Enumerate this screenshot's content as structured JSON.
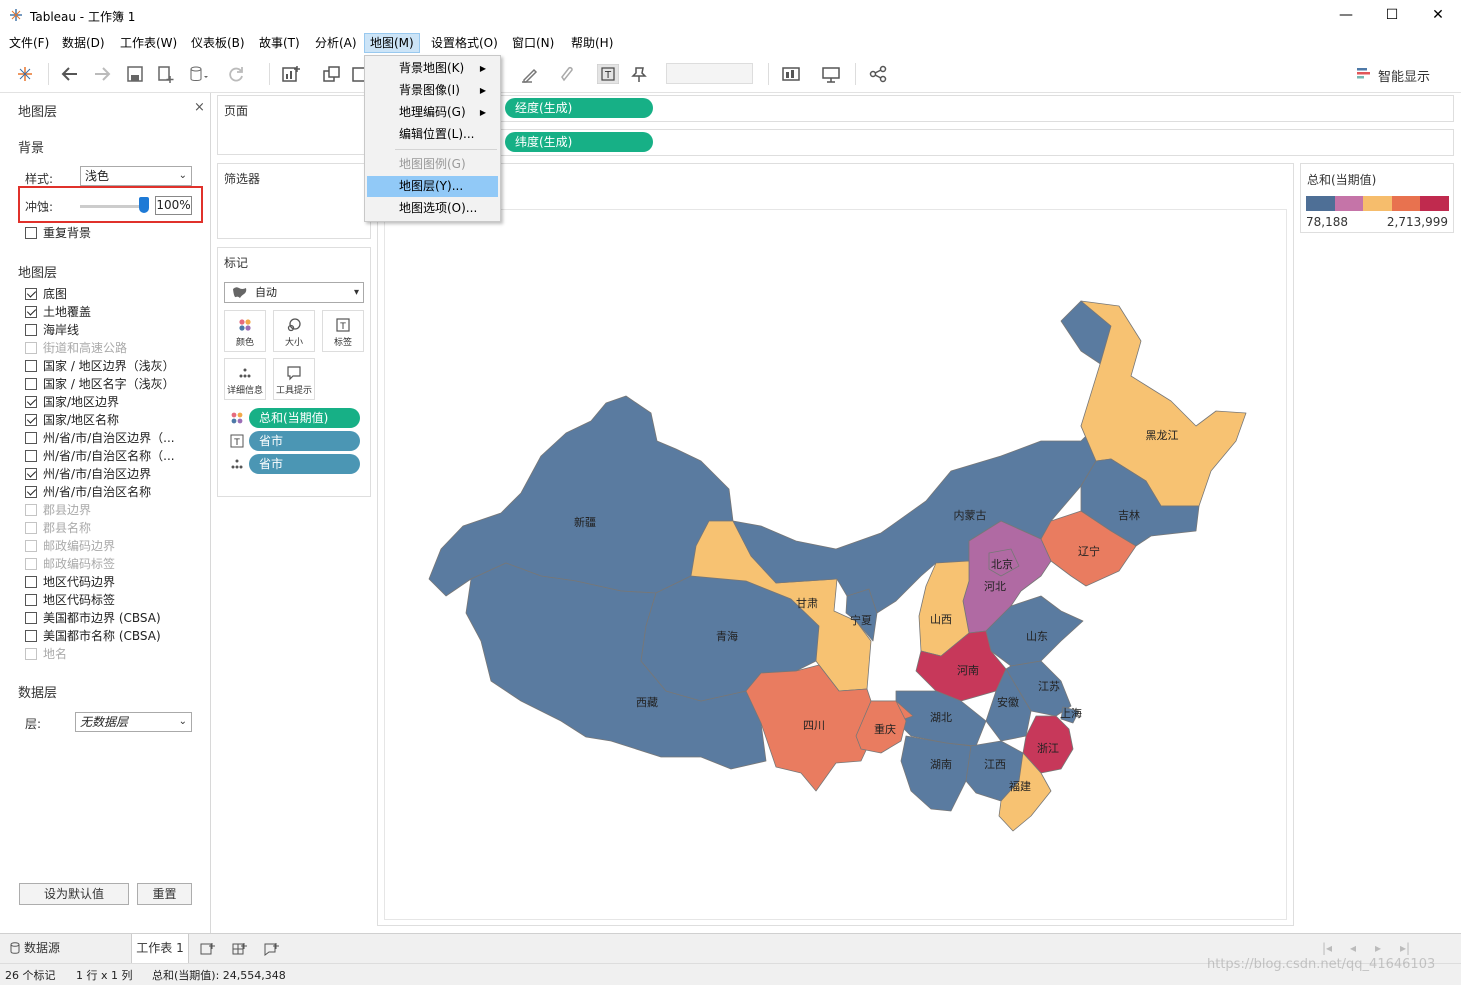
{
  "window": {
    "title": "Tableau - 工作簿 1",
    "minimize": "—",
    "maximize": "☐",
    "close": "✕"
  },
  "menubar": [
    "文件(F)",
    "数据(D)",
    "工作表(W)",
    "仪表板(B)",
    "故事(T)",
    "分析(A)",
    "地图(M)",
    "设置格式(O)",
    "窗口(N)",
    "帮助(H)"
  ],
  "toolbar": {
    "smart_show": "智能显示"
  },
  "map_menu": {
    "items": [
      {
        "label": "背景地图(K)",
        "submenu": true,
        "enabled": true
      },
      {
        "label": "背景图像(I)",
        "submenu": true,
        "enabled": true
      },
      {
        "label": "地理编码(G)",
        "submenu": true,
        "enabled": true
      },
      {
        "label": "编辑位置(L)...",
        "submenu": false,
        "enabled": true
      },
      {
        "label": "地图图例(G)",
        "submenu": false,
        "enabled": false
      },
      {
        "label": "地图层(Y)...",
        "submenu": false,
        "enabled": true,
        "highlighted": true
      },
      {
        "label": "地图选项(O)...",
        "submenu": false,
        "enabled": true
      }
    ]
  },
  "left_panel": {
    "title": "地图层",
    "close": "×",
    "background": {
      "heading": "背景",
      "style_label": "样式:",
      "style_value": "浅色",
      "wash_label": "冲蚀:",
      "wash_value": "100%",
      "wash_level": 1.0,
      "repeat_label": "重复背景"
    },
    "layers_heading": "地图层",
    "layers": [
      {
        "label": "底图",
        "checked": true,
        "enabled": true
      },
      {
        "label": "土地覆盖",
        "checked": true,
        "enabled": true
      },
      {
        "label": "海岸线",
        "checked": false,
        "enabled": true
      },
      {
        "label": "街道和高速公路",
        "checked": false,
        "enabled": false
      },
      {
        "label": "国家 / 地区边界（浅灰）",
        "checked": false,
        "enabled": true
      },
      {
        "label": "国家 / 地区名字（浅灰）",
        "checked": false,
        "enabled": true
      },
      {
        "label": "国家/地区边界",
        "checked": true,
        "enabled": true
      },
      {
        "label": "国家/地区名称",
        "checked": true,
        "enabled": true
      },
      {
        "label": "州/省/市/自治区边界（...",
        "checked": false,
        "enabled": true
      },
      {
        "label": "州/省/市/自治区名称（...",
        "checked": false,
        "enabled": true
      },
      {
        "label": "州/省/市/自治区边界",
        "checked": true,
        "enabled": true
      },
      {
        "label": "州/省/市/自治区名称",
        "checked": true,
        "enabled": true
      },
      {
        "label": "郡县边界",
        "checked": false,
        "enabled": false
      },
      {
        "label": "郡县名称",
        "checked": false,
        "enabled": false
      },
      {
        "label": "邮政编码边界",
        "checked": false,
        "enabled": false
      },
      {
        "label": "邮政编码标签",
        "checked": false,
        "enabled": false
      },
      {
        "label": "地区代码边界",
        "checked": false,
        "enabled": true
      },
      {
        "label": "地区代码标签",
        "checked": false,
        "enabled": true
      },
      {
        "label": "美国都市边界 (CBSA)",
        "checked": false,
        "enabled": true
      },
      {
        "label": "美国都市名称 (CBSA)",
        "checked": false,
        "enabled": true
      },
      {
        "label": "地名",
        "checked": false,
        "enabled": false
      }
    ],
    "data_layer": {
      "heading": "数据层",
      "layer_label": "层:",
      "layer_value": "无数据层"
    },
    "set_default_button": "设为默认值",
    "reset_button": "重置"
  },
  "cards": {
    "pages": "页面",
    "filters": "筛选器",
    "marks": {
      "title": "标记",
      "type": "自动",
      "buttons": [
        "颜色",
        "大小",
        "标签",
        "详细信息",
        "工具提示"
      ],
      "fields": [
        {
          "kind": "color",
          "label": "总和(当期值)",
          "style": "green"
        },
        {
          "kind": "label",
          "label": "省市",
          "style": "blue"
        },
        {
          "kind": "detail",
          "label": "省市",
          "style": "blue"
        }
      ]
    }
  },
  "shelves": {
    "columns": "经度(生成)",
    "rows": "纬度(生成)"
  },
  "legend": {
    "title": "总和(当期值)",
    "min": "78,188",
    "max": "2,713,999",
    "colors": [
      "#4e6f96",
      "#c574a8",
      "#f6bd6c",
      "#e8724f",
      "#c02a4e"
    ]
  },
  "map": {
    "colors": {
      "blue": "#5a7ba0",
      "yellow": "#f7c272",
      "orange": "#e97c60",
      "red": "#c7385a",
      "purple": "#b06aa3"
    },
    "labels": [
      "新疆",
      "西藏",
      "青海",
      "甘肃",
      "宁夏",
      "内蒙古",
      "黑龙江",
      "吉林",
      "辽宁",
      "北京",
      "河北",
      "山西",
      "山东",
      "河南",
      "江苏",
      "安徽",
      "上海",
      "湖北",
      "四川",
      "重庆",
      "浙江",
      "湖南",
      "江西",
      "福建"
    ]
  },
  "tabs": {
    "datasource": "数据源",
    "sheet": "工作表 1"
  },
  "status": {
    "marks": "26 个标记",
    "rows_cols": "1 行 x 1 列",
    "sum": "总和(当期值): 24,554,348"
  },
  "watermark": "https://blog.csdn.net/qq_41646103"
}
